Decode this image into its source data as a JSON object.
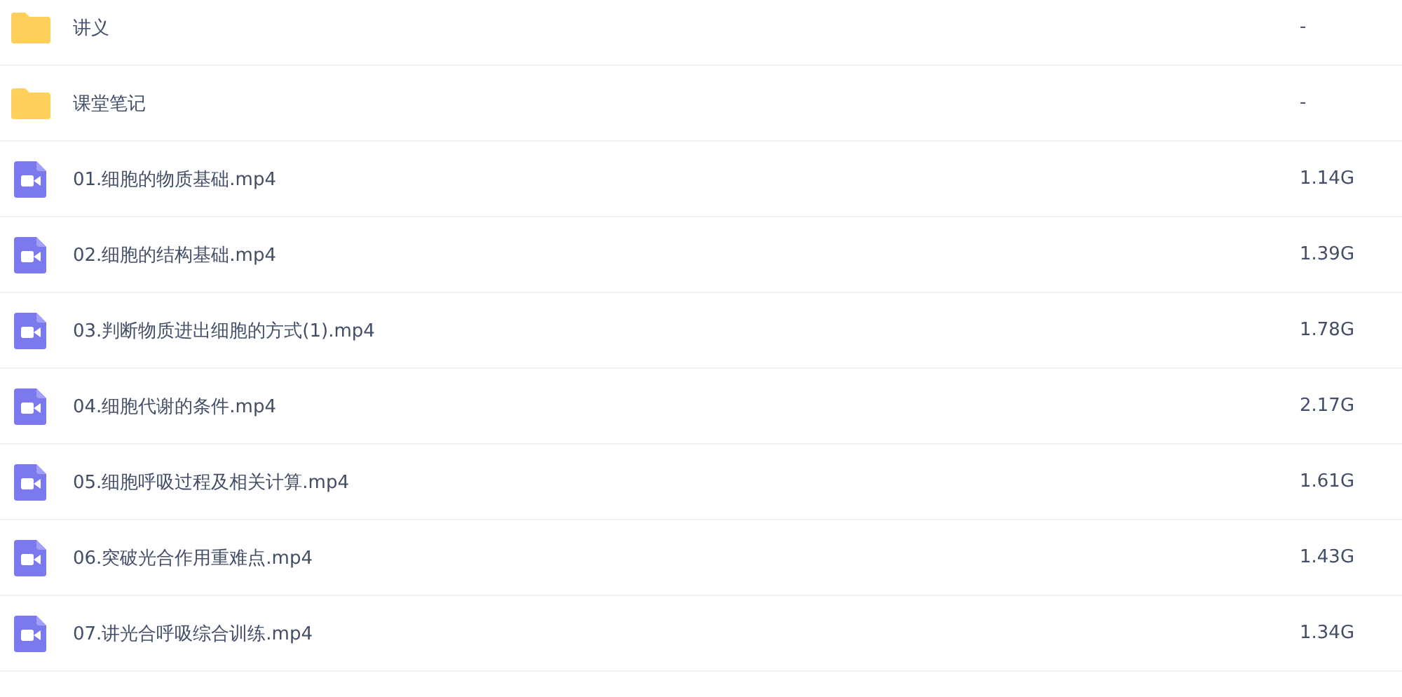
{
  "files": [
    {
      "kind": "folder",
      "name": "讲义",
      "size": "-"
    },
    {
      "kind": "folder",
      "name": "课堂笔记",
      "size": "-"
    },
    {
      "kind": "video",
      "name": "01.细胞的物质基础.mp4",
      "size": "1.14G"
    },
    {
      "kind": "video",
      "name": "02.细胞的结构基础.mp4",
      "size": "1.39G"
    },
    {
      "kind": "video",
      "name": "03.判断物质进出细胞的方式(1).mp4",
      "size": "1.78G"
    },
    {
      "kind": "video",
      "name": "04.细胞代谢的条件.mp4",
      "size": "2.17G"
    },
    {
      "kind": "video",
      "name": "05.细胞呼吸过程及相关计算.mp4",
      "size": "1.61G"
    },
    {
      "kind": "video",
      "name": "06.突破光合作用重难点.mp4",
      "size": "1.43G"
    },
    {
      "kind": "video",
      "name": "07.讲光合呼吸综合训练.mp4",
      "size": "1.34G"
    }
  ]
}
